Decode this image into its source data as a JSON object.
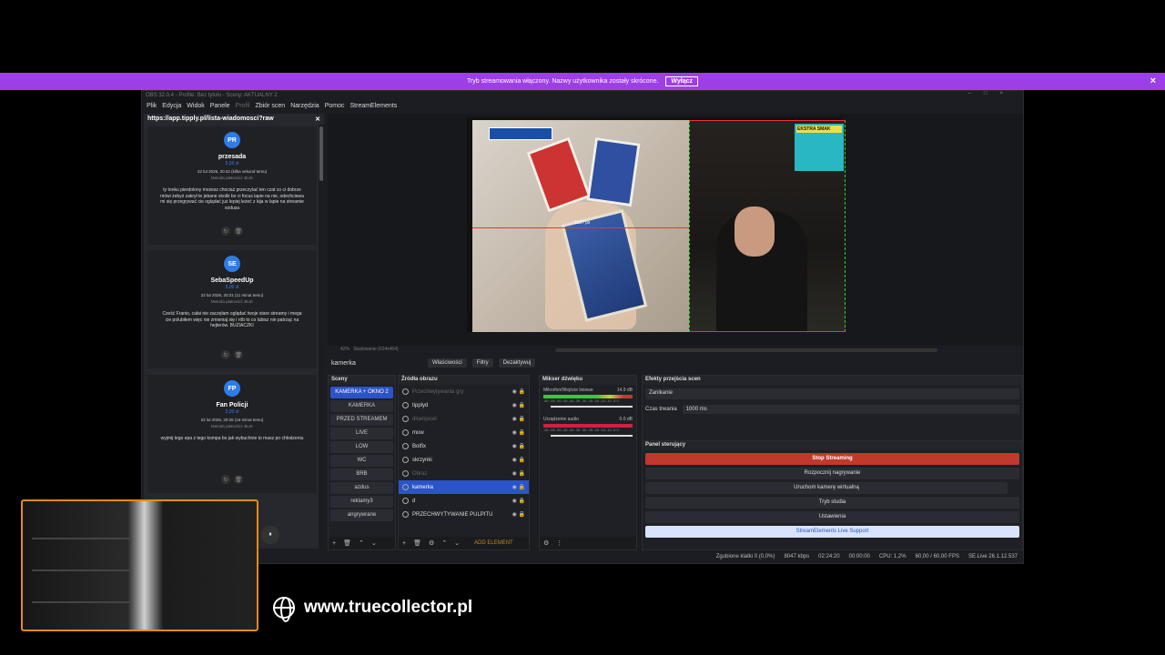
{
  "banner": {
    "text": "Tryb streamowania włączony. Nazwy użytkownika zostały skrócone.",
    "button": "Wyłącz",
    "close": "×"
  },
  "obs": {
    "title": "OBS 32.0.4 - Profile: Bez tytułu - Sceny: AKTUALNY 2",
    "menu": [
      "Plik",
      "Edycja",
      "Widok",
      "Panele",
      "Profil",
      "Zbiór scen",
      "Narzędzia",
      "Pomoc",
      "StreamElements"
    ],
    "tipply": {
      "url": "https://app.tipply.pl/lista-wiadomosci?raw",
      "donations": [
        {
          "initials": "PR",
          "name": "przesada",
          "amount": "5,00 zł",
          "date": "22 lut 2026, 20:42 (kilka sekund temu)",
          "method": "Metoda płatności: BLIK",
          "message": "ty tonku pierdolony możesz chociaż przeczytać ten czat co ci dobrze mówi żebyś zakrył te jebane skolki bo ci focus lapie na nie, odechciewa mi się przegrywać cie oglądać już lepiej leżeć z kija w lapie na streamie ezdusa"
        },
        {
          "initials": "SE",
          "name": "SebaSpeedUp",
          "amount": "5,00 zł",
          "date": "22 lut 2026, 20:31 (11 minut temu)",
          "method": "Metoda płatności: BLIK",
          "message": "Cześć Franio, całai nie zaczęłam oglądać twoje stare streamy i mega cie polubiłem więc nie zmieniaj się i rób to co lubisz nie patrząc na hejterów. BUZIACZKI"
        },
        {
          "initials": "FP",
          "name": "Fan Policji",
          "amount": "5,00 zł",
          "date": "22 lut 2026, 20:26 (16 minut temu)",
          "method": "Metoda płatności: BLIK",
          "message": "wyjmij tego epa z tego kompa bo jak wybuchnie to masz po chłodzeniu"
        }
      ]
    },
    "preview": {
      "measure": "1137 px",
      "zoom": "42%",
      "scale": "Skalowanie (624x464)"
    },
    "source_bar": {
      "selected": "kamerka",
      "properties": "Właściwości",
      "filters": "Filtry",
      "deactivate": "Dezaktywuj"
    },
    "scenes": {
      "title": "Sceny",
      "items": [
        "KAMERKA + OKNO 2",
        "KAMERKA",
        "PRZED STREAMEM",
        "LIVE",
        "LOW",
        "WC",
        "BRB",
        "azdus",
        "reklamy3",
        "angrywrane"
      ]
    },
    "sources": {
      "title": "Źródła obrazu",
      "items": [
        "Przechwytywania gry",
        "tipplyd",
        "disenjocel",
        "muw",
        "Botfix",
        "skrzynki",
        "Obraz",
        "kamerka",
        "d",
        "PRZECHWYTYWANIE PULPITU"
      ],
      "add": "ADD ELEMENT"
    },
    "mixer": {
      "title": "Mikser dźwięku",
      "ch1": "Mikrofon/Wejście liniowe",
      "ch1_db": "14.9 dB",
      "ch2": "Urządzenie audio",
      "ch2_db": "0.0 dB",
      "scale": "-60 -55 -50 -45 -40 -35 -30 -25 -20 -15 -10 -5 0"
    },
    "transitions": {
      "title": "Efekty przejścia scen",
      "type": "Zanikanie",
      "duration_label": "Czas trwania",
      "duration": "1000 ms"
    },
    "controls": {
      "title": "Panel sterujący",
      "stop": "Stop Streaming",
      "record": "Rozpocznij nagrywanie",
      "virtualcam": "Uruchom kamerę wirtualną",
      "studio": "Tryb studia",
      "settings": "Ustawienia",
      "se": "StreamElements Live Support"
    },
    "status": {
      "dropped": "Zgubione klatki 0 (0,0%)",
      "kbps": "8047 kbps",
      "live_time": "02:24:20",
      "rec_time": "00:00:00",
      "cpu": "CPU: 1,2%",
      "fps": "60,00 / 60,00 FPS",
      "se_ver": "SE.Live 26.1.12.537"
    }
  },
  "overlay": {
    "website": "www.truecollector.pl",
    "pause": "⏸"
  },
  "colors": {
    "banner": "#9d3fe6",
    "active": "#2b54c8",
    "stop": "#c0392b",
    "webcam_border": "#e88a1a"
  }
}
